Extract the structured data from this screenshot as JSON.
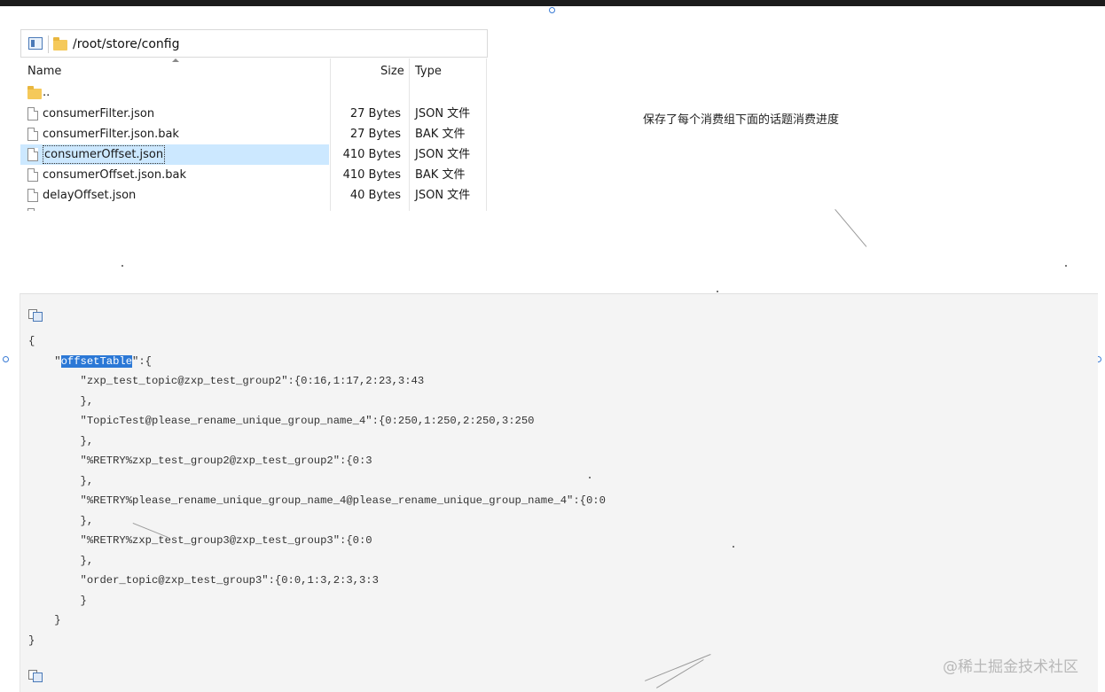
{
  "explorer": {
    "path": "/root/store/config",
    "columns": {
      "name": "Name",
      "size": "Size",
      "type": "Type"
    },
    "parent_entry": "..",
    "files": [
      {
        "name": "consumerFilter.json",
        "size": "27 Bytes",
        "type": "JSON 文件",
        "selected": false
      },
      {
        "name": "consumerFilter.json.bak",
        "size": "27 Bytes",
        "type": "BAK 文件",
        "selected": false
      },
      {
        "name": "consumerOffset.json",
        "size": "410 Bytes",
        "type": "JSON 文件",
        "selected": true
      },
      {
        "name": "consumerOffset.json.bak",
        "size": "410 Bytes",
        "type": "BAK 文件",
        "selected": false
      },
      {
        "name": "delayOffset.json",
        "size": "40 Bytes",
        "type": "JSON 文件",
        "selected": false
      }
    ]
  },
  "annotation": "保存了每个消费组下面的话题消费进度",
  "code": {
    "lines": [
      "{",
      "    \"offsetTable\":{",
      "        \"zxp_test_topic@zxp_test_group2\":{0:16,1:17,2:23,3:43",
      "        },",
      "        \"TopicTest@please_rename_unique_group_name_4\":{0:250,1:250,2:250,3:250",
      "        },",
      "        \"%RETRY%zxp_test_group2@zxp_test_group2\":{0:3",
      "        },",
      "        \"%RETRY%please_rename_unique_group_name_4@please_rename_unique_group_name_4\":{0:0",
      "        },",
      "        \"%RETRY%zxp_test_group3@zxp_test_group3\":{0:0",
      "        },",
      "        \"order_topic@zxp_test_group3\":{0:0,1:3,2:3,3:3",
      "        }",
      "    }",
      "}"
    ],
    "highlighted_word": "offsetTable"
  },
  "watermark": "@稀土掘金技术社区",
  "icons": {
    "view_toggle": "view-pane-icon",
    "folder": "folder-icon",
    "file": "file-icon",
    "copy": "copy-code-icon"
  },
  "colors": {
    "selection": "#cce8ff",
    "highlight": "#2b78d6",
    "code_bg": "#f4f4f4"
  }
}
